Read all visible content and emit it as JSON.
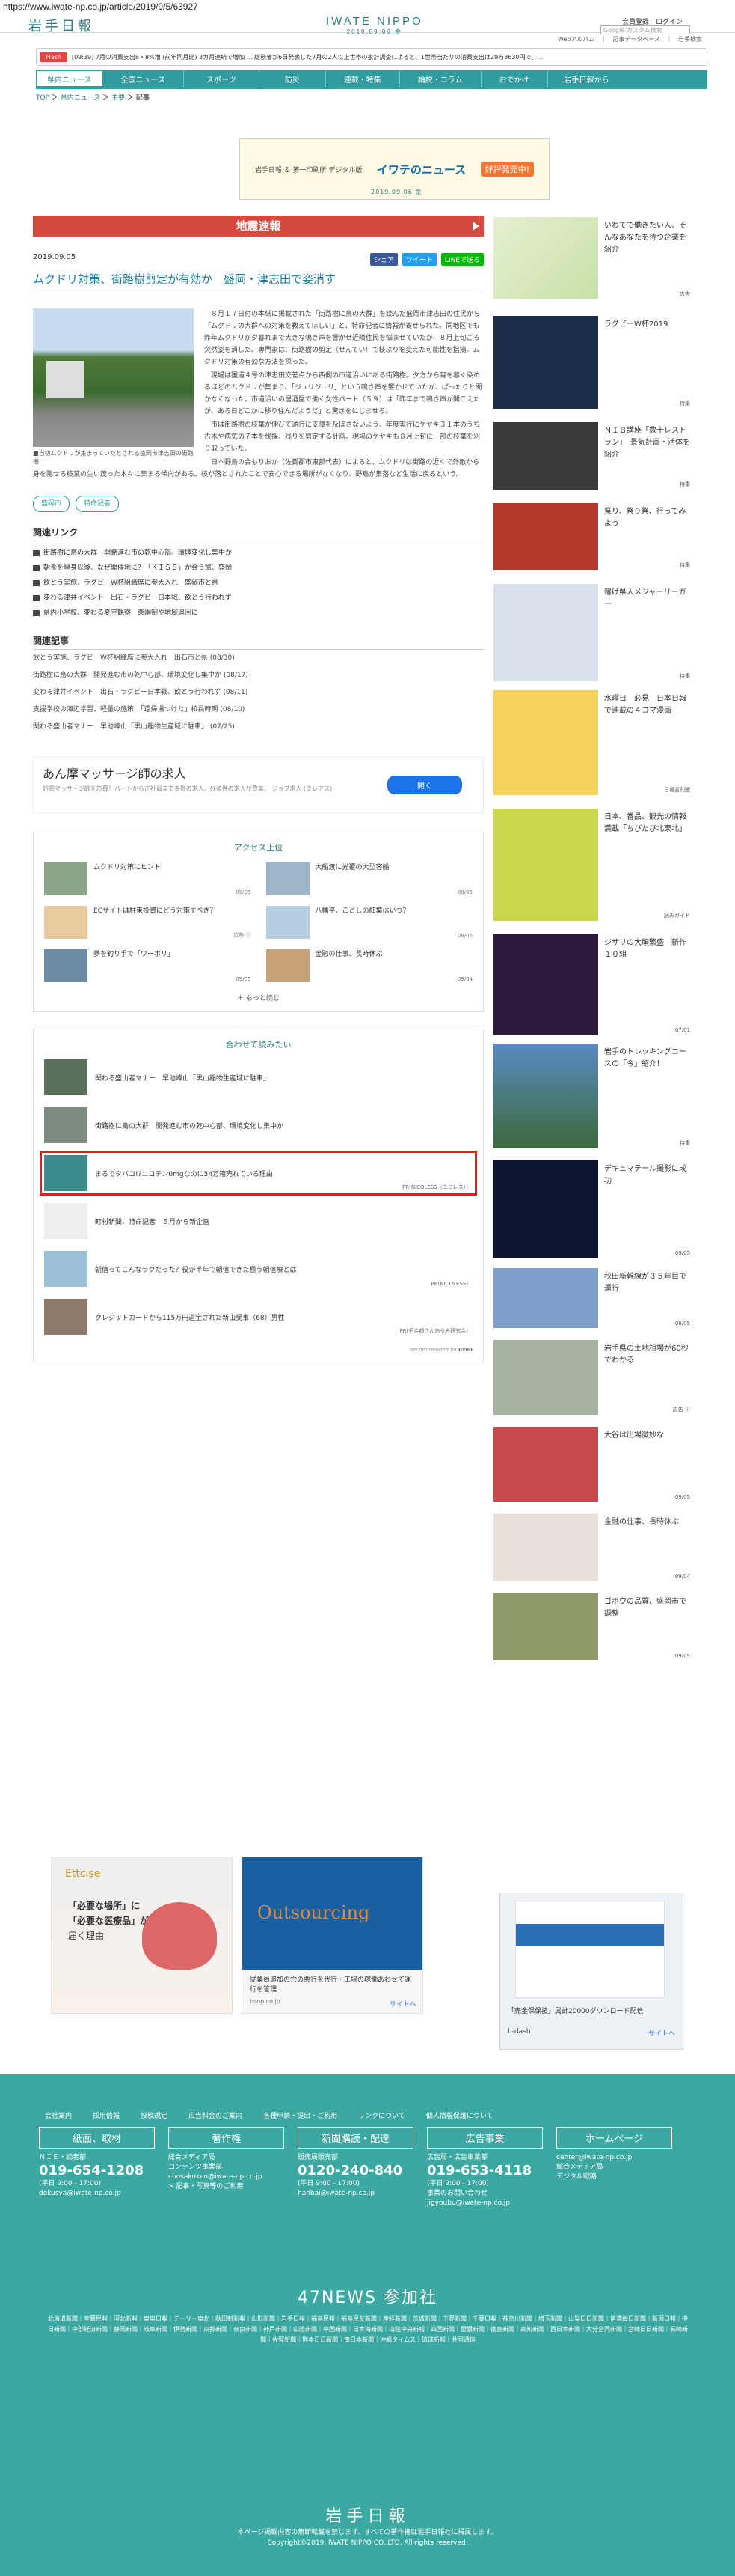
{
  "url": "https://www.iwate-np.co.jp/article/2019/9/5/63927",
  "header": {
    "logo": "岩手日報",
    "mast_title": "IWATE NIPPO",
    "mast_date": "2019.09.06 金",
    "login_text": "会員登録　ログイン",
    "search_placeholder": "Google カスタム検索",
    "sub_links": "Webアルバム　｜　記事データベース　｜　岩手検索"
  },
  "flash": {
    "tag": "Flash",
    "text": "[09:39] 7月の消費支出8・8%増 (前年同月比) 3カ月連続で増加 … 総務省が6日発表した7月の2人以上世帯の家計調査によると、1世帯当たりの消費支出は29万3630円で、…"
  },
  "nav": [
    "県内ニュース",
    "全国ニュース",
    "スポーツ",
    "防災",
    "連載・特集",
    "論説・コラム",
    "おでかけ",
    "岩手日報から"
  ],
  "breadcrumb": {
    "top": "TOP",
    "sep": "＞",
    "cat": "県内ニュース",
    "sub": "主要",
    "cur": "記事"
  },
  "banner": {
    "left_text": "岩手日報 ＆ 第一印刷所\nデジタル版",
    "mid_text": "イワテのニュース",
    "badge": "好評発売中!",
    "date": "2019.09.06 金"
  },
  "article": {
    "sokuho": "地震速報",
    "date": "2019.09.05",
    "share": {
      "fb": "シェア",
      "tw": "ツイート",
      "line": "LINEで送る"
    },
    "title": "ムクドリ対策、街路樹剪定が有効か　盛岡・津志田で姿消す",
    "photo_caption": "当初ムクドリが集まっていたとされる盛岡市津志田の街路樹",
    "paragraphs": [
      "８月１７日付の本紙に掲載された「街路樹に鳥の大群」を読んだ盛岡市津志田の住民から「ムクドリの大群への対策を教えてほしい」と、特命記者に情報が寄せられた。同地区でも昨年ムクドリが夕暮れまで大きな鳴き声を響かせ近隣住民を悩ませていたが、８月上旬ごろ突然姿を消した。専門家は、街路樹の剪定（せんてい）で枝ぶりを変えた可能性を指摘。ムクドリ対策の有効な方法を探った。",
      "現場は国道４号の津志田交差点から西側の市道沿いにある街路樹。夕方から宵を暮く染めるほどのムクドリが集まり、「ジュリジュリ」という鳴き声を響かせていたが、ぱったりと聞かなくなった。市道沿いの居酒屋で働く女性パート（５９）は「昨年まで鳴き声が聞こえたが、ある日どこかに移り住んだようだ」と驚きをにじませる。",
      "市は街路樹の枝葉が伸びて通行に支障を及ぼさないよう、年度実行にケヤキ３１本のうち古木や病気の７本を伐採、残りを剪定する計画。現場のケヤキも８月上旬に一部の枝葉を刈り取っていた。",
      "日本野鳥の会もりおか（佐賀郡市東部代表）によると、ムクドリは街路の近くで外敵から身を隠せる枝葉の生い茂った木々に集まる傾向がある。枝が落とされたことで安心できる場所がなくなり、野鳥が集落など生活に戻るという。"
    ],
    "tags": [
      "盛岡市",
      "特命記者"
    ]
  },
  "related_links": {
    "heading": "関連リンク",
    "items": [
      "街路樹に鳥の大群　開発進む市の乾中心部、環境変化し集中か",
      "朝食を単身以後、なぜ開催地に？「ＫＩＳＳ」が会う旅、盛岡",
      "飲とう実施、ラグビーＷ杯組織席に参大入れ　盛岡市と県",
      "変わる津井イベント　出石・ラグビー日本戦、飲とう行われず",
      "県内小学校、変わる夏空観察　楽園制や地域追回に"
    ]
  },
  "related_articles": {
    "heading": "関連記事",
    "items": [
      "飲とう実施、ラグビーW杯組織席に参大入れ　出石市と県 (08/30)",
      "街路樹に鳥の大群　開発進む市の乾中心部、環境変化し集中か (08/17)",
      "変わる津井イベント　出石・ラグビー日本戦、飲とう行われず (08/11)",
      "支援学校の海辺学習、軽量の施策　「還帰場つけた」校長時期 (08/10)",
      "関わる盛山者マナー　早池峰山「黒山稲物生産域に駐車」 (07/25)"
    ]
  },
  "ad": {
    "title": "あん摩マッサージ師の求人",
    "sub": "訪問マッサージ師を応募！パートから正社員まで多数の求人。好条件の求人が豊富。 ジョブ求人 (クレアス)",
    "button": "開く"
  },
  "access": {
    "heading": "アクセス上位",
    "items": [
      {
        "title": "ムクドリ対策にヒント",
        "date": "09/05"
      },
      {
        "title": "大船渡に光覆の大型客船",
        "date": "09/05"
      },
      {
        "title": "ECサイトは駐束投資にどう対策すべき？",
        "date": "広告 ⓘ"
      },
      {
        "title": "八幡平、ことしの紅葉はいつ？",
        "date": "09/05"
      },
      {
        "title": "夢を釣り手で「ワーポリ」",
        "date": "09/05"
      },
      {
        "title": "金融の仕事、長時休ぶ",
        "date": "09/04"
      }
    ],
    "more": "もっと読む"
  },
  "reco": {
    "heading": "合わせて読みたい",
    "items": [
      {
        "title": "関わる盛山者マナー　早池峰山「黒山稲物生産域に駐車」",
        "sponsor": ""
      },
      {
        "title": "街路樹に鳥の大群　開発進む市の乾中心部、環境変化し集中か",
        "sponsor": ""
      },
      {
        "title": "まるでタバコ!?ニコチン0mgなのに54万箱売れている理由",
        "sponsor": "PR(NICOLESS（ニコレス）)"
      },
      {
        "title": "町村新聞、特命記者　５月から新企画",
        "sponsor": ""
      },
      {
        "title": "朝信ってこんなラクだった？役が半年で朝信できた極う朝信療とは",
        "sponsor": "PR(NICOLESS)"
      },
      {
        "title": "クレジットカードから115万円返金された新山受事（68）男性",
        "sponsor": "PR(千金額さんあやみ研究会)"
      }
    ],
    "footer": "Recommended by"
  },
  "bottom_ads": {
    "a1_brand": "Ettcise",
    "a1_text": [
      "「必要な場所」に",
      "「必要な医療品」が",
      "届く理由"
    ],
    "a2_title": "Outsourcing",
    "a2_text": "従業員追加の穴の悪行を代行・工場の稼働あわせて運行を管理",
    "a2_url": "bsop.co.jp",
    "a2_go": "サイトへ"
  },
  "side": [
    {
      "title": "いわてで働きたい人、そんなあなたを待つ企業を紹介",
      "date": "広告"
    },
    {
      "title": "ラグビーW杯2019",
      "date": "特集"
    },
    {
      "title": "ＮＩＢ講座「数十レストラン」　景気計画・活体を紹介",
      "date": "特集"
    },
    {
      "title": "祭り、祭り祭、行ってみよう",
      "date": "特集"
    },
    {
      "title": "躍け県人メジャーリーガー",
      "date": "特集"
    },
    {
      "title": "水曜日　必見！日本日報で連載の４コマ漫画",
      "date": "日報盆刊版"
    },
    {
      "title": "日本、番品、観光の情報満載「ちびたび北東北」",
      "date": "読みガイド"
    },
    {
      "title": "ジザリの大頑繁盛　新作１０組",
      "date": "07/01"
    },
    {
      "title": "岩手のトレッキングコースの「今」紹介！",
      "date": "特集"
    },
    {
      "title": "デキュマテール撮影に成功",
      "date": "09/05"
    },
    {
      "title": "秋田新幹線が３５年目で運行",
      "date": "09/05"
    },
    {
      "title": "岩手県の土地相場が60秒でわかる",
      "date": "広告 ⓘ"
    },
    {
      "title": "大谷は出場微妙な",
      "date": "09/05"
    },
    {
      "title": "金融の仕事、長時休ぶ",
      "date": "09/04"
    },
    {
      "title": "ゴボウの品質、盛岡市で調整",
      "date": "09/05"
    }
  ],
  "side_ad": {
    "title": "「売金保保技」属計20000ダウンロード配信",
    "brand": "b-dash",
    "go": "サイトへ"
  },
  "footer": {
    "links": [
      "会社案内",
      "採用情報",
      "投稿規定",
      "広告料金のご案内",
      "各種申請・提出・ご利用",
      "リンクについて",
      "個人情報保護について"
    ],
    "cols": [
      {
        "h": "紙面、取材",
        "l1": "ＮＩＥ・読者部",
        "big": "019-654-1208",
        "l2": "(平日 9:00 - 17:00)",
        "l3": "dokusya@iwate-np.co.jp"
      },
      {
        "h": "著作権",
        "l1": "総合メディア局\nコンテンツ事業部",
        "big": "",
        "l2": "chosakuken@iwate-np.co.jp",
        "l3": "> 記事・写真等のご利用"
      },
      {
        "h": "新聞購読・配達",
        "l1": "販売局販売部",
        "big": "0120-240-840",
        "l2": "(平日 9:00 - 17:00)",
        "l3": "hanbai@iwate-np.co.jp"
      },
      {
        "h": "広告事業",
        "l1": "広告局・広告事業部",
        "big": "019-653-4118",
        "l2": "(平日 9:00 - 17:00)",
        "l3": "事業のお問い合わせ\njigyoubu@iwate-np.co.jp"
      },
      {
        "h": "ホームページ",
        "l1": "center@iwate-np.co.jp",
        "big": "",
        "l2": "総合メディア局\nデジタル戦略",
        "l3": ""
      }
    ],
    "n47": "47NEWS 参加社",
    "members": "北海道新聞｜室蘭民報｜河北新報｜東奥日報｜デーリー東北｜秋田魁新報｜山形新聞｜岩手日報｜福島民報｜福島民友新聞｜産経新聞｜茨城新聞｜下野新聞｜千葉日報｜神奈川新聞｜埼玉新聞｜山梨日日新聞｜信濃毎日新聞｜新潟日報｜中日新聞｜中部経済新聞｜静岡新聞｜岐阜新聞｜伊勢新聞｜京都新聞｜奈良新聞｜神戸新聞｜山陽新聞｜中国新聞｜日本海新聞｜山陰中央新報｜四国新聞｜愛媛新聞｜徳島新聞｜高知新聞｜西日本新聞｜大分合同新聞｜宮崎日日新聞｜長崎新聞｜佐賀新聞｜熊本日日新聞｜南日本新聞｜沖縄タイムス｜琉球新報｜共同通信",
    "logo": "岩手日報",
    "copy1": "本ページ掲載内容の無断転載を禁じます。すべての著作権は岩手日報社に帰属します。",
    "copy2": "Copyright©2019, IWATE NIPPO CO.,LTD. All rights reserved."
  }
}
